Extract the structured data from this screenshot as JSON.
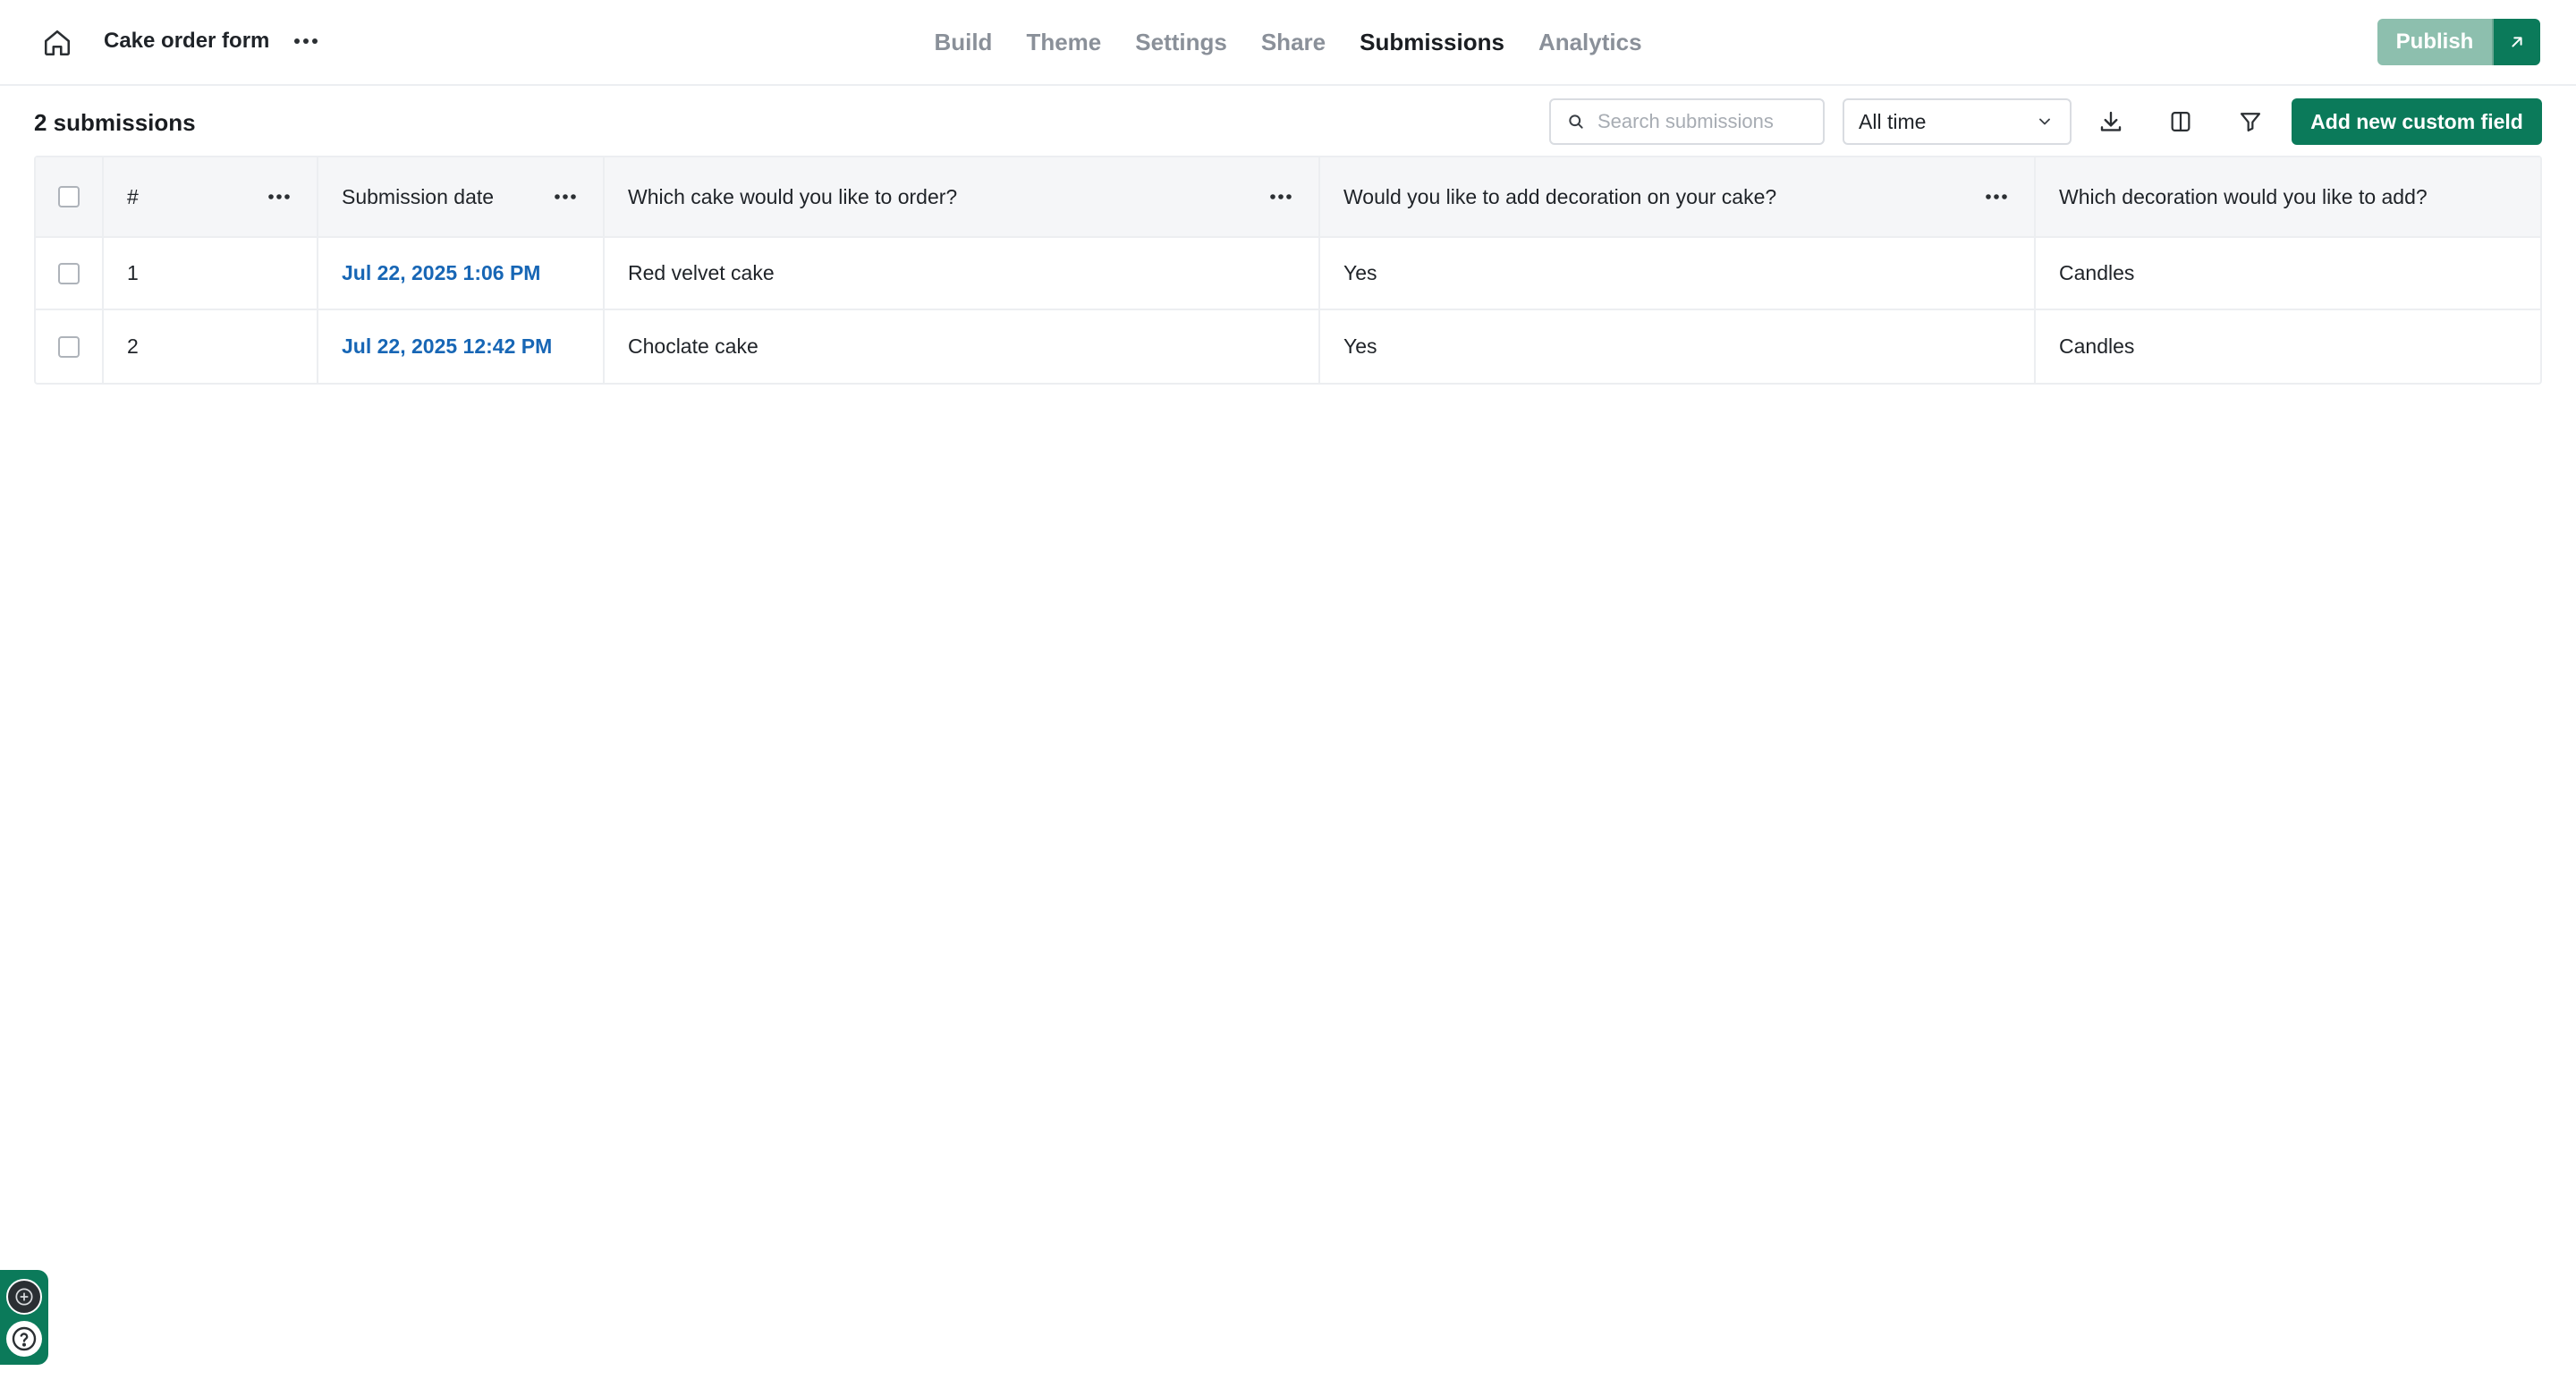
{
  "header": {
    "form_title": "Cake order form",
    "tabs": [
      {
        "label": "Build",
        "active": false
      },
      {
        "label": "Theme",
        "active": false
      },
      {
        "label": "Settings",
        "active": false
      },
      {
        "label": "Share",
        "active": false
      },
      {
        "label": "Submissions",
        "active": true
      },
      {
        "label": "Analytics",
        "active": false
      }
    ],
    "publish_label": "Publish"
  },
  "toolbar": {
    "count_label": "2 submissions",
    "search_placeholder": "Search submissions",
    "search_value": "",
    "range_value": "All time",
    "add_field_label": "Add new custom field"
  },
  "table": {
    "columns": [
      "#",
      "Submission date",
      "Which cake would you like to order?",
      "Would you like to add decoration on your cake?",
      "Which decoration would you like to add?"
    ],
    "rows": [
      {
        "num": "1",
        "date": "Jul 22, 2025 1:06 PM",
        "cake": "Red velvet cake",
        "decoration": "Yes",
        "which_decoration": "Candles"
      },
      {
        "num": "2",
        "date": "Jul 22, 2025 12:42 PM",
        "cake": "Choclate cake",
        "decoration": "Yes",
        "which_decoration": "Candles"
      }
    ]
  },
  "icons": {
    "home": "home-icon",
    "more": "more-horizontal-icon",
    "external": "arrow-up-right-icon",
    "search": "search-icon",
    "chevron": "chevron-down-icon",
    "download": "download-icon",
    "columns": "columns-icon",
    "filter": "filter-icon",
    "help": "help-circle-icon"
  },
  "colors": {
    "brand": "#0b7a5a",
    "publish_disabled": "#8dbfae",
    "link": "#1766b5",
    "muted_tab": "#8a9099"
  }
}
